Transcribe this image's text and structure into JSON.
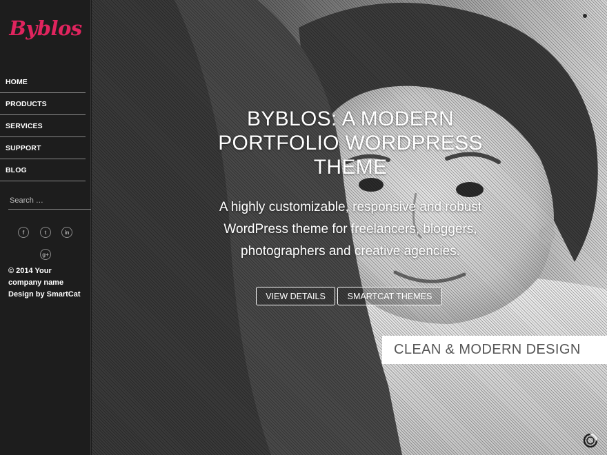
{
  "sidebar": {
    "logo": "Byblos",
    "nav": [
      {
        "label": "HOME"
      },
      {
        "label": "PRODUCTS"
      },
      {
        "label": "SERVICES"
      },
      {
        "label": "SUPPORT"
      },
      {
        "label": "BLOG"
      }
    ],
    "search": {
      "placeholder": "Search …",
      "value": ""
    },
    "social": [
      {
        "icon": "facebook-icon",
        "glyph": "f"
      },
      {
        "icon": "twitter-icon",
        "glyph": "t"
      },
      {
        "icon": "linkedin-icon",
        "glyph": "in"
      },
      {
        "icon": "google-plus-icon",
        "glyph": "g+"
      }
    ],
    "copyright": {
      "line1": "© 2014 Your",
      "line2": "company name",
      "line3": "Design by SmartCat"
    }
  },
  "hero": {
    "title_lines": [
      "BYBLOS: A MODERN",
      "PORTFOLIO WORDPRESS",
      "THEME"
    ],
    "subtitle_lines": [
      "A highly customizable, responsive and robust",
      "WordPress theme for freelancers, bloggers,",
      "photographers and creative agencies."
    ],
    "buttons": {
      "details": "VIEW DETAILS",
      "smartcat": "SMARTCAT THEMES"
    },
    "caption": "CLEAN & MODERN DESIGN"
  },
  "colors": {
    "brand": "#e0245e",
    "sidebar_bg": "#1d1d1d",
    "caption_bg": "#ffffff",
    "caption_text": "#555555"
  }
}
